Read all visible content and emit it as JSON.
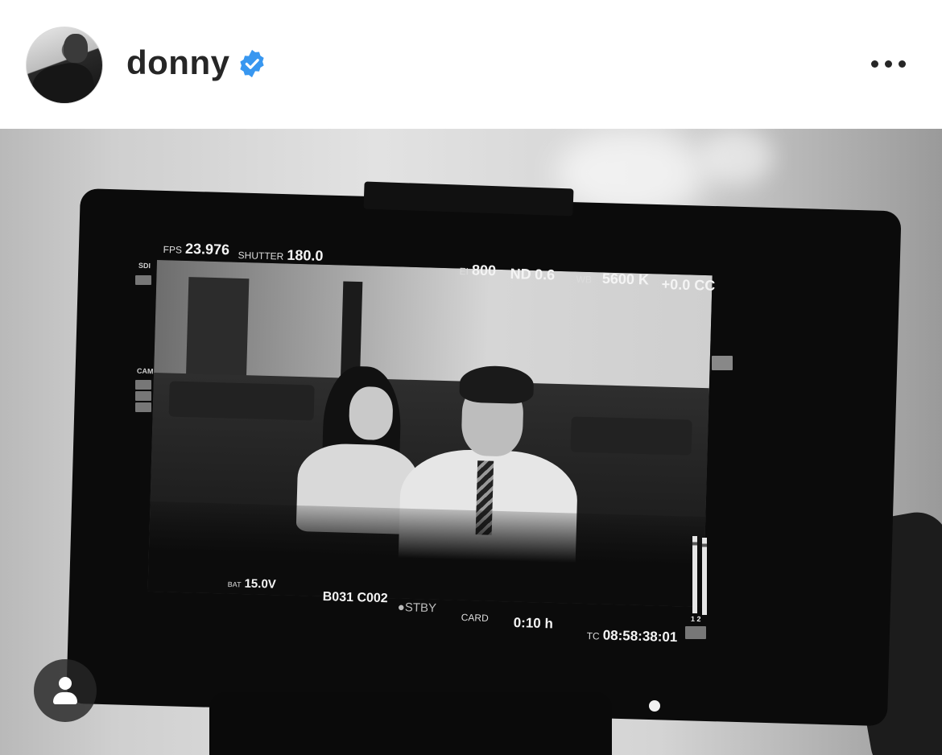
{
  "post": {
    "username": "donny",
    "verified_icon": "verified-badge-icon",
    "more_icon": "more-options-icon",
    "accent_color": "#3897f0"
  },
  "monitor_osd": {
    "fps_label": "FPS",
    "fps_value": "23.976",
    "shutter_label": "SHUTTER",
    "shutter_value": "180.0",
    "ei_label": "EI",
    "ei_value": "800",
    "nd_label": "ND",
    "nd_value": "0.6",
    "wb_label": "WB",
    "wb_value": "5600 K",
    "cc_value": "+0.0 CC",
    "bat_label": "BAT",
    "bat_value": "15.0V",
    "clip": "B031 C002",
    "status": "●STBY",
    "card_label": "CARD",
    "card_value": "0:10 h",
    "tc_label": "TC",
    "tc_value": "08:58:38:01",
    "sdi_label": "SDI",
    "cam_label": "CAM",
    "meter_labels": "1 2"
  },
  "user_tag_icon": "user-tag-icon"
}
